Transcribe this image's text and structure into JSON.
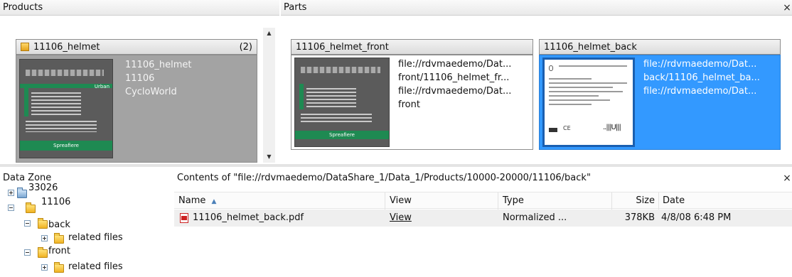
{
  "panels": {
    "products_title": "Products",
    "parts_title": "Parts",
    "datazone_title": "Data Zone",
    "contents_title": "Contents of \"file://rdvmaedemo/DataShare_1/Data_1/Products/10000-20000/11106/back\"",
    "close_glyph": "×"
  },
  "product": {
    "title": "11106_helmet",
    "count": "(2)",
    "meta": [
      "11106_helmet",
      "11106",
      "CycloWorld"
    ],
    "thumb_band": "Spreafiere",
    "thumb_tag": "Urban"
  },
  "parts": [
    {
      "title": "11106_helmet_front",
      "meta": [
        "file://rdvmaedemo/Dat...",
        "front/11106_helmet_fr...",
        "file://rdvmaedemo/Dat...",
        "front"
      ],
      "selected": false
    },
    {
      "title": "11106_helmet_back",
      "meta": [
        "file://rdvmaedemo/Dat...",
        "back/11106_helmet_ba...",
        "file://rdvmaedemo/Dat..."
      ],
      "selected": true,
      "thumb_mark": "CE",
      "thumb_barcode": "..|||U|||"
    }
  ],
  "tree": {
    "items": [
      {
        "label": "33026"
      },
      {
        "label": "11106"
      },
      {
        "label": "back"
      },
      {
        "label": "related files"
      },
      {
        "label": "front"
      },
      {
        "label": "related files"
      }
    ]
  },
  "table": {
    "columns": {
      "name": "Name",
      "view": "View",
      "type": "Type",
      "size": "Size",
      "date": "Date"
    },
    "sort_glyph": "▲",
    "rows": [
      {
        "name": "11106_helmet_back.pdf",
        "view": "View",
        "type": "Normalized ...",
        "size": "378KB",
        "date": "4/8/08 6:48 PM"
      }
    ]
  },
  "colors": {
    "selection": "#3399ff",
    "product_bg": "#a3a3a3",
    "thumb_green": "#1e8a52",
    "pdf_red": "#cc2222"
  }
}
